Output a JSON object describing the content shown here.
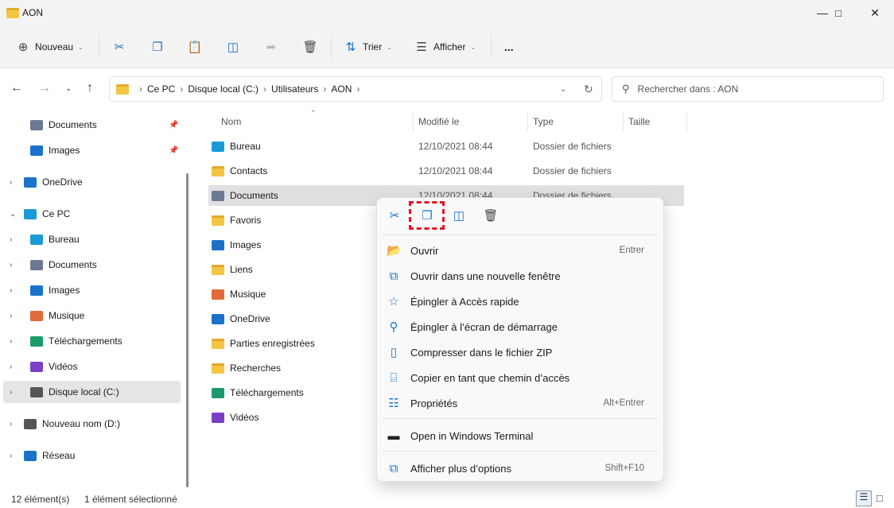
{
  "window": {
    "title": "AON"
  },
  "toolbar": {
    "new": "Nouveau",
    "sort": "Trier",
    "view": "Afficher",
    "more": "..."
  },
  "address": {
    "segments": [
      "Ce PC",
      "Disque local (C:)",
      "Utilisateurs",
      "AON"
    ]
  },
  "search": {
    "placeholder": "Rechercher dans : AON"
  },
  "sidebar": {
    "items": [
      {
        "label": "Documents",
        "pinned": true
      },
      {
        "label": "Images",
        "pinned": true
      },
      {
        "label": "OneDrive"
      },
      {
        "label": "Ce PC"
      },
      {
        "label": "Bureau"
      },
      {
        "label": "Documents"
      },
      {
        "label": "Images"
      },
      {
        "label": "Musique"
      },
      {
        "label": "Téléchargements"
      },
      {
        "label": "Vidéos"
      },
      {
        "label": "Disque local (C:)",
        "selected": true
      },
      {
        "label": "Nouveau nom (D:)"
      },
      {
        "label": "Réseau"
      }
    ]
  },
  "columns": {
    "name": "Nom",
    "modified": "Modifié le",
    "type": "Type",
    "size": "Taille"
  },
  "files": [
    {
      "name": "Bureau",
      "date": "12/10/2021 08:44",
      "type": "Dossier de fichiers"
    },
    {
      "name": "Contacts",
      "date": "12/10/2021 08:44",
      "type": "Dossier de fichiers"
    },
    {
      "name": "Documents",
      "date": "12/10/2021 08:44",
      "type": "Dossier de fichiers"
    },
    {
      "name": "Favoris"
    },
    {
      "name": "Images"
    },
    {
      "name": "Liens"
    },
    {
      "name": "Musique"
    },
    {
      "name": "OneDrive"
    },
    {
      "name": "Parties enregistrées"
    },
    {
      "name": "Recherches"
    },
    {
      "name": "Téléchargements"
    },
    {
      "name": "Vidéos"
    }
  ],
  "context_menu": {
    "items": [
      {
        "label": "Ouvrir",
        "shortcut": "Entrer"
      },
      {
        "label": "Ouvrir dans une nouvelle fenêtre"
      },
      {
        "label": "Épingler à Accès rapide"
      },
      {
        "label": "Épingler à l’écran de démarrage"
      },
      {
        "label": "Compresser dans le fichier ZIP"
      },
      {
        "label": "Copier en tant que chemin d’accès"
      },
      {
        "label": "Propriétés",
        "shortcut": "Alt+Entrer"
      },
      {
        "label": "Open in Windows Terminal"
      },
      {
        "label": "Afficher plus d’options",
        "shortcut": "Shift+F10"
      }
    ],
    "highlight_color": "#e81123"
  },
  "status": {
    "count": "12 élément(s)",
    "selected": "1 élément sélectionné"
  }
}
